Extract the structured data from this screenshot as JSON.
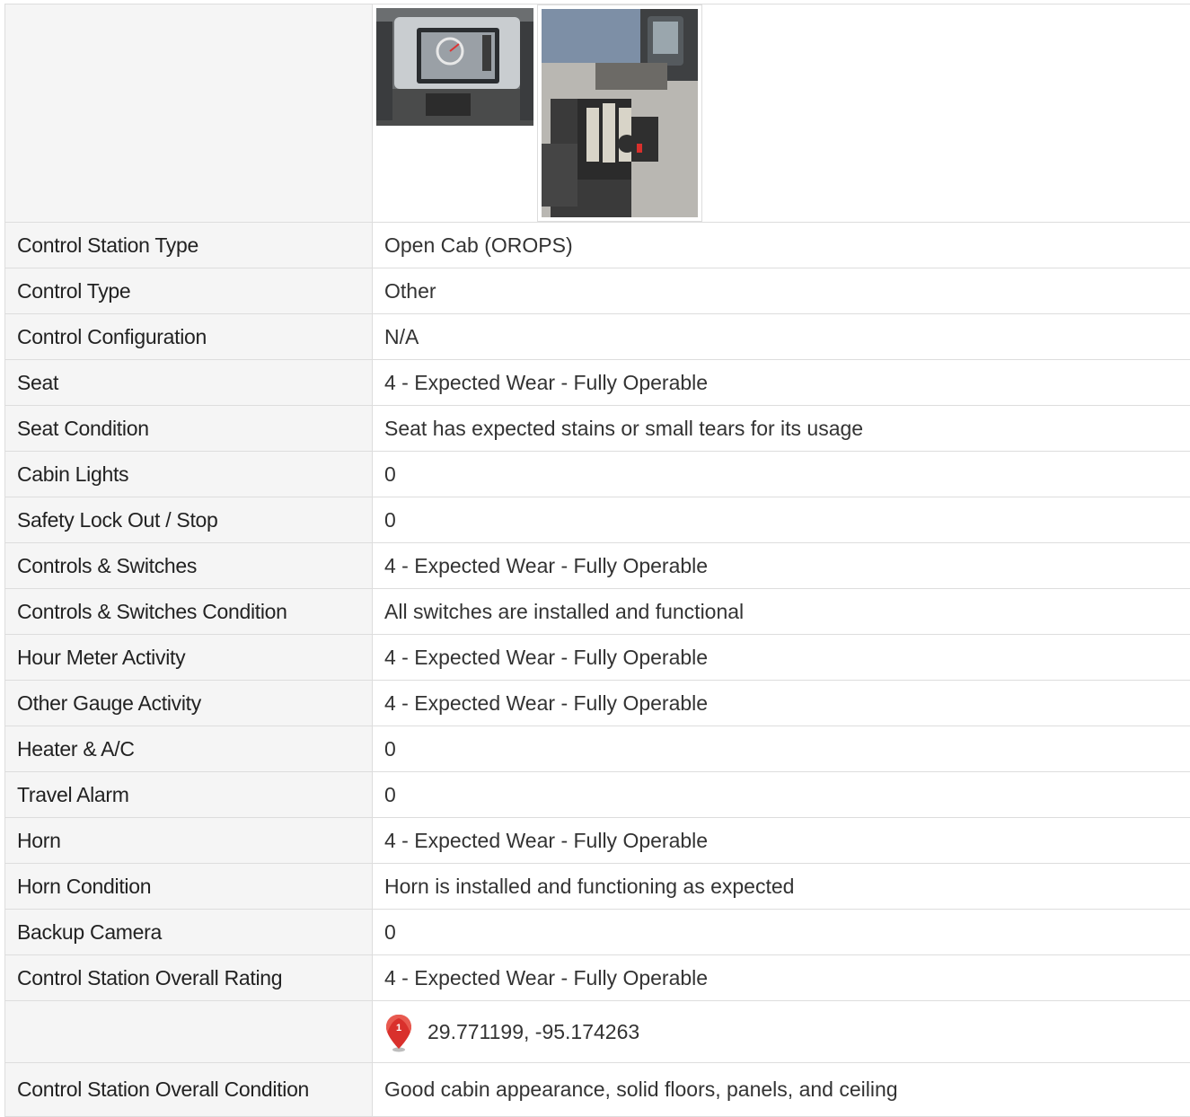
{
  "photos": [
    {
      "icon": "dashboard-photo"
    },
    {
      "icon": "controls-photo"
    }
  ],
  "rows": [
    {
      "label": "Control Station Type",
      "value": "Open Cab (OROPS)"
    },
    {
      "label": "Control Type",
      "value": "Other"
    },
    {
      "label": "Control Configuration",
      "value": "N/A"
    },
    {
      "label": "Seat",
      "value": "4 - Expected Wear - Fully Operable"
    },
    {
      "label": "Seat Condition",
      "value": "Seat has expected stains or small tears for its usage"
    },
    {
      "label": "Cabin Lights",
      "value": "0"
    },
    {
      "label": "Safety Lock Out / Stop",
      "value": "0"
    },
    {
      "label": "Controls & Switches",
      "value": "4 - Expected Wear - Fully Operable"
    },
    {
      "label": "Controls & Switches Condition",
      "value": "All switches are installed and functional"
    },
    {
      "label": "Hour Meter Activity",
      "value": "4 - Expected Wear - Fully Operable"
    },
    {
      "label": "Other Gauge Activity",
      "value": "4 - Expected Wear - Fully Operable"
    },
    {
      "label": "Heater & A/C",
      "value": "0"
    },
    {
      "label": "Travel Alarm",
      "value": "0"
    },
    {
      "label": "Horn",
      "value": "4 - Expected Wear - Fully Operable"
    },
    {
      "label": "Horn Condition",
      "value": "Horn is installed and functioning as expected"
    },
    {
      "label": "Backup Camera",
      "value": "0"
    },
    {
      "label": "Control Station Overall Rating",
      "value": "4 - Expected Wear - Fully Operable"
    }
  ],
  "location": {
    "pin_number": "1",
    "coordinates": "29.771199, -95.174263",
    "pin_color": "#d9302c"
  },
  "last_row": {
    "label": "Control Station Overall Condition",
    "value": "Good cabin appearance, solid floors, panels, and ceiling"
  }
}
